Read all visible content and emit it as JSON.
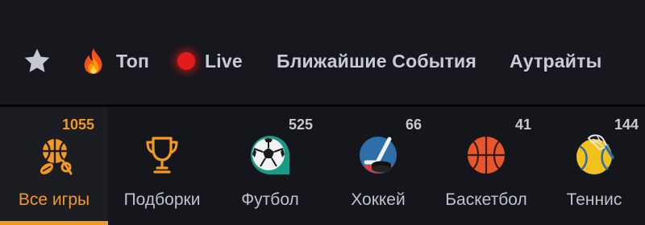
{
  "nav": {
    "favorites_icon": "star-icon",
    "items": [
      {
        "label": "Топ",
        "icon": "fire-icon"
      },
      {
        "label": "Live",
        "icon": "live-dot-icon"
      },
      {
        "label": "Ближайшие События"
      },
      {
        "label": "Аутрайты"
      }
    ]
  },
  "sports": [
    {
      "label": "Все игры",
      "count": "1055",
      "icon": "all-sports-icon",
      "active": true
    },
    {
      "label": "Подборки",
      "count": "",
      "icon": "trophy-icon"
    },
    {
      "label": "Футбол",
      "count": "525",
      "icon": "soccer-ball-icon"
    },
    {
      "label": "Хоккей",
      "count": "66",
      "icon": "hockey-icon"
    },
    {
      "label": "Баскетбол",
      "count": "41",
      "icon": "basketball-icon"
    },
    {
      "label": "Теннис",
      "count": "144",
      "icon": "tennis-ball-icon"
    }
  ],
  "colors": {
    "accent": "#f39a1e",
    "background": "#15161b",
    "live": "#e51a1a",
    "text": "#c9ccd3"
  }
}
